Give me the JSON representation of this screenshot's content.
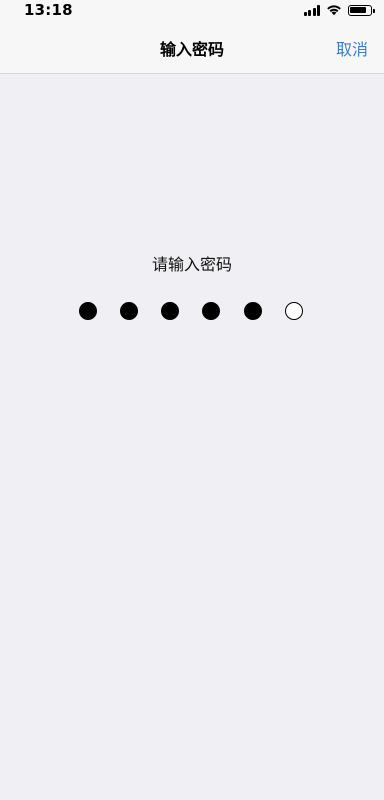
{
  "status_bar": {
    "time": "13:18",
    "signal_icon": "cellular-signal-icon",
    "wifi_icon": "wifi-icon",
    "battery_icon": "battery-icon",
    "battery_level": 0.85
  },
  "nav": {
    "title": "输入密码",
    "cancel_label": "取消",
    "accent_color": "#3b7fc4"
  },
  "prompt": "请输入密码",
  "passcode": {
    "length": 6,
    "entered": 5
  }
}
